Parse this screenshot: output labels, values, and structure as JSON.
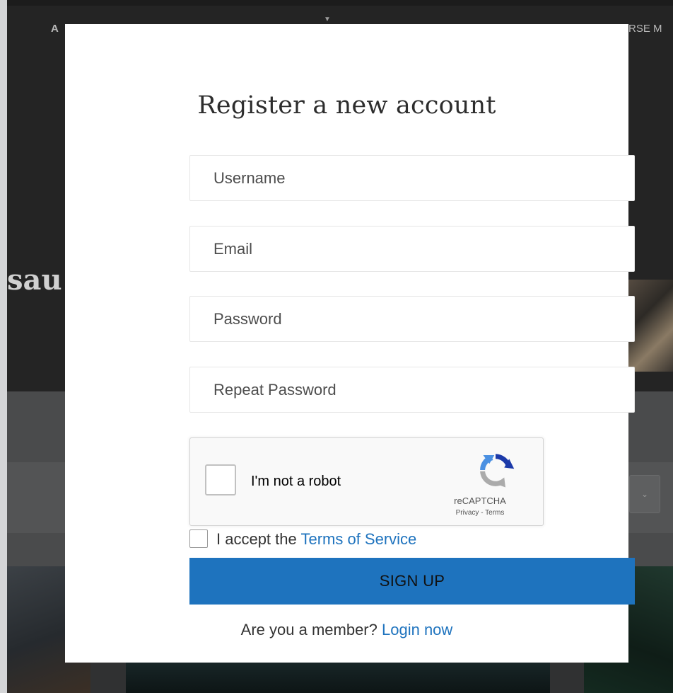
{
  "background": {
    "nav_left_text": "A",
    "nav_right_text": "RSE M",
    "hero_text_fragment": "sau",
    "select_chevron_icon": "chevron-down-icon"
  },
  "modal": {
    "title": "Register a new account",
    "fields": {
      "username_placeholder": "Username",
      "email_placeholder": "Email",
      "password_placeholder": "Password",
      "repeat_password_placeholder": "Repeat Password"
    },
    "recaptcha": {
      "label": "I'm not a robot",
      "brand": "reCAPTCHA",
      "privacy": "Privacy",
      "separator": "-",
      "terms": "Terms",
      "logo_icon": "recaptcha-logo-icon",
      "checked": false
    },
    "terms": {
      "prefix": "I accept the",
      "link": "Terms of Service",
      "checked": false
    },
    "signup_label": "SIGN UP",
    "member_prompt": "Are you a member?",
    "login_link": "Login now"
  },
  "colors": {
    "accent": "#1e73be",
    "overlay": "#1c1c1c",
    "modal_bg": "#ffffff"
  }
}
